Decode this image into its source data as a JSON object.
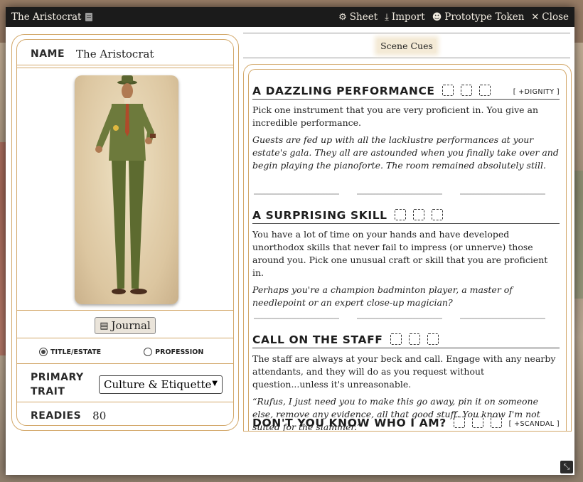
{
  "window": {
    "title": "The Aristocrat",
    "buttons": [
      {
        "label": "Sheet",
        "icon": "gear-icon",
        "glyph": "⚙"
      },
      {
        "label": "Import",
        "icon": "download-icon",
        "glyph": "⤓"
      },
      {
        "label": "Prototype Token",
        "icon": "user-circle-icon",
        "glyph": "☻"
      },
      {
        "label": "Close",
        "icon": "close-icon",
        "glyph": "✕"
      }
    ]
  },
  "sheet": {
    "name_label": "NAME",
    "name_value": "The Aristocrat",
    "journal_label": "Journal",
    "radio_title": "Title/Estate",
    "radio_profession": "Profession",
    "primary_label_1": "PRIMARY",
    "primary_label_2": "TRAIT",
    "primary_trait_value": "Culture & Etiquette",
    "readies_label": "READIES",
    "readies_value": "80"
  },
  "tabs": {
    "scene_cues": "Scene Cues"
  },
  "cues": [
    {
      "title": "A DAZZLING PERFORMANCE",
      "tag": "[ +DIGNITY ]",
      "body": "Pick one instrument that you are very proficient in. You give an incredible performance.",
      "flavor": "Guests are fed up with all the lacklustre performances at your estate's gala. They all are astounded when you finally take over and begin playing the pianoforte. The room remained absolutely still."
    },
    {
      "title": "A SURPRISING SKILL",
      "tag": "",
      "body": "You have a lot of time on your hands and have developed unorthodox skills that never fail to impress (or unnerve) those around you. Pick one unusual craft or skill that you are proficient in.",
      "flavor": "Perhaps you're a champion badminton player, a master of needlepoint or an expert close-up magician?"
    },
    {
      "title": "CALL ON THE STAFF",
      "tag": "",
      "body": "The staff are always at your beck and call. Engage with any nearby attendants, and they will do as you request without question...unless it's unreasonable.",
      "flavor": "“Rufus, I just need you to make this go away, pin it on someone else, remove any evidence, all that good stuff. You know I'm not suited for the slammer.”"
    },
    {
      "title": "DON'T YOU KNOW WHO I AM?",
      "tag": "[ +SCANDAL ]",
      "body": "",
      "flavor": ""
    }
  ]
}
